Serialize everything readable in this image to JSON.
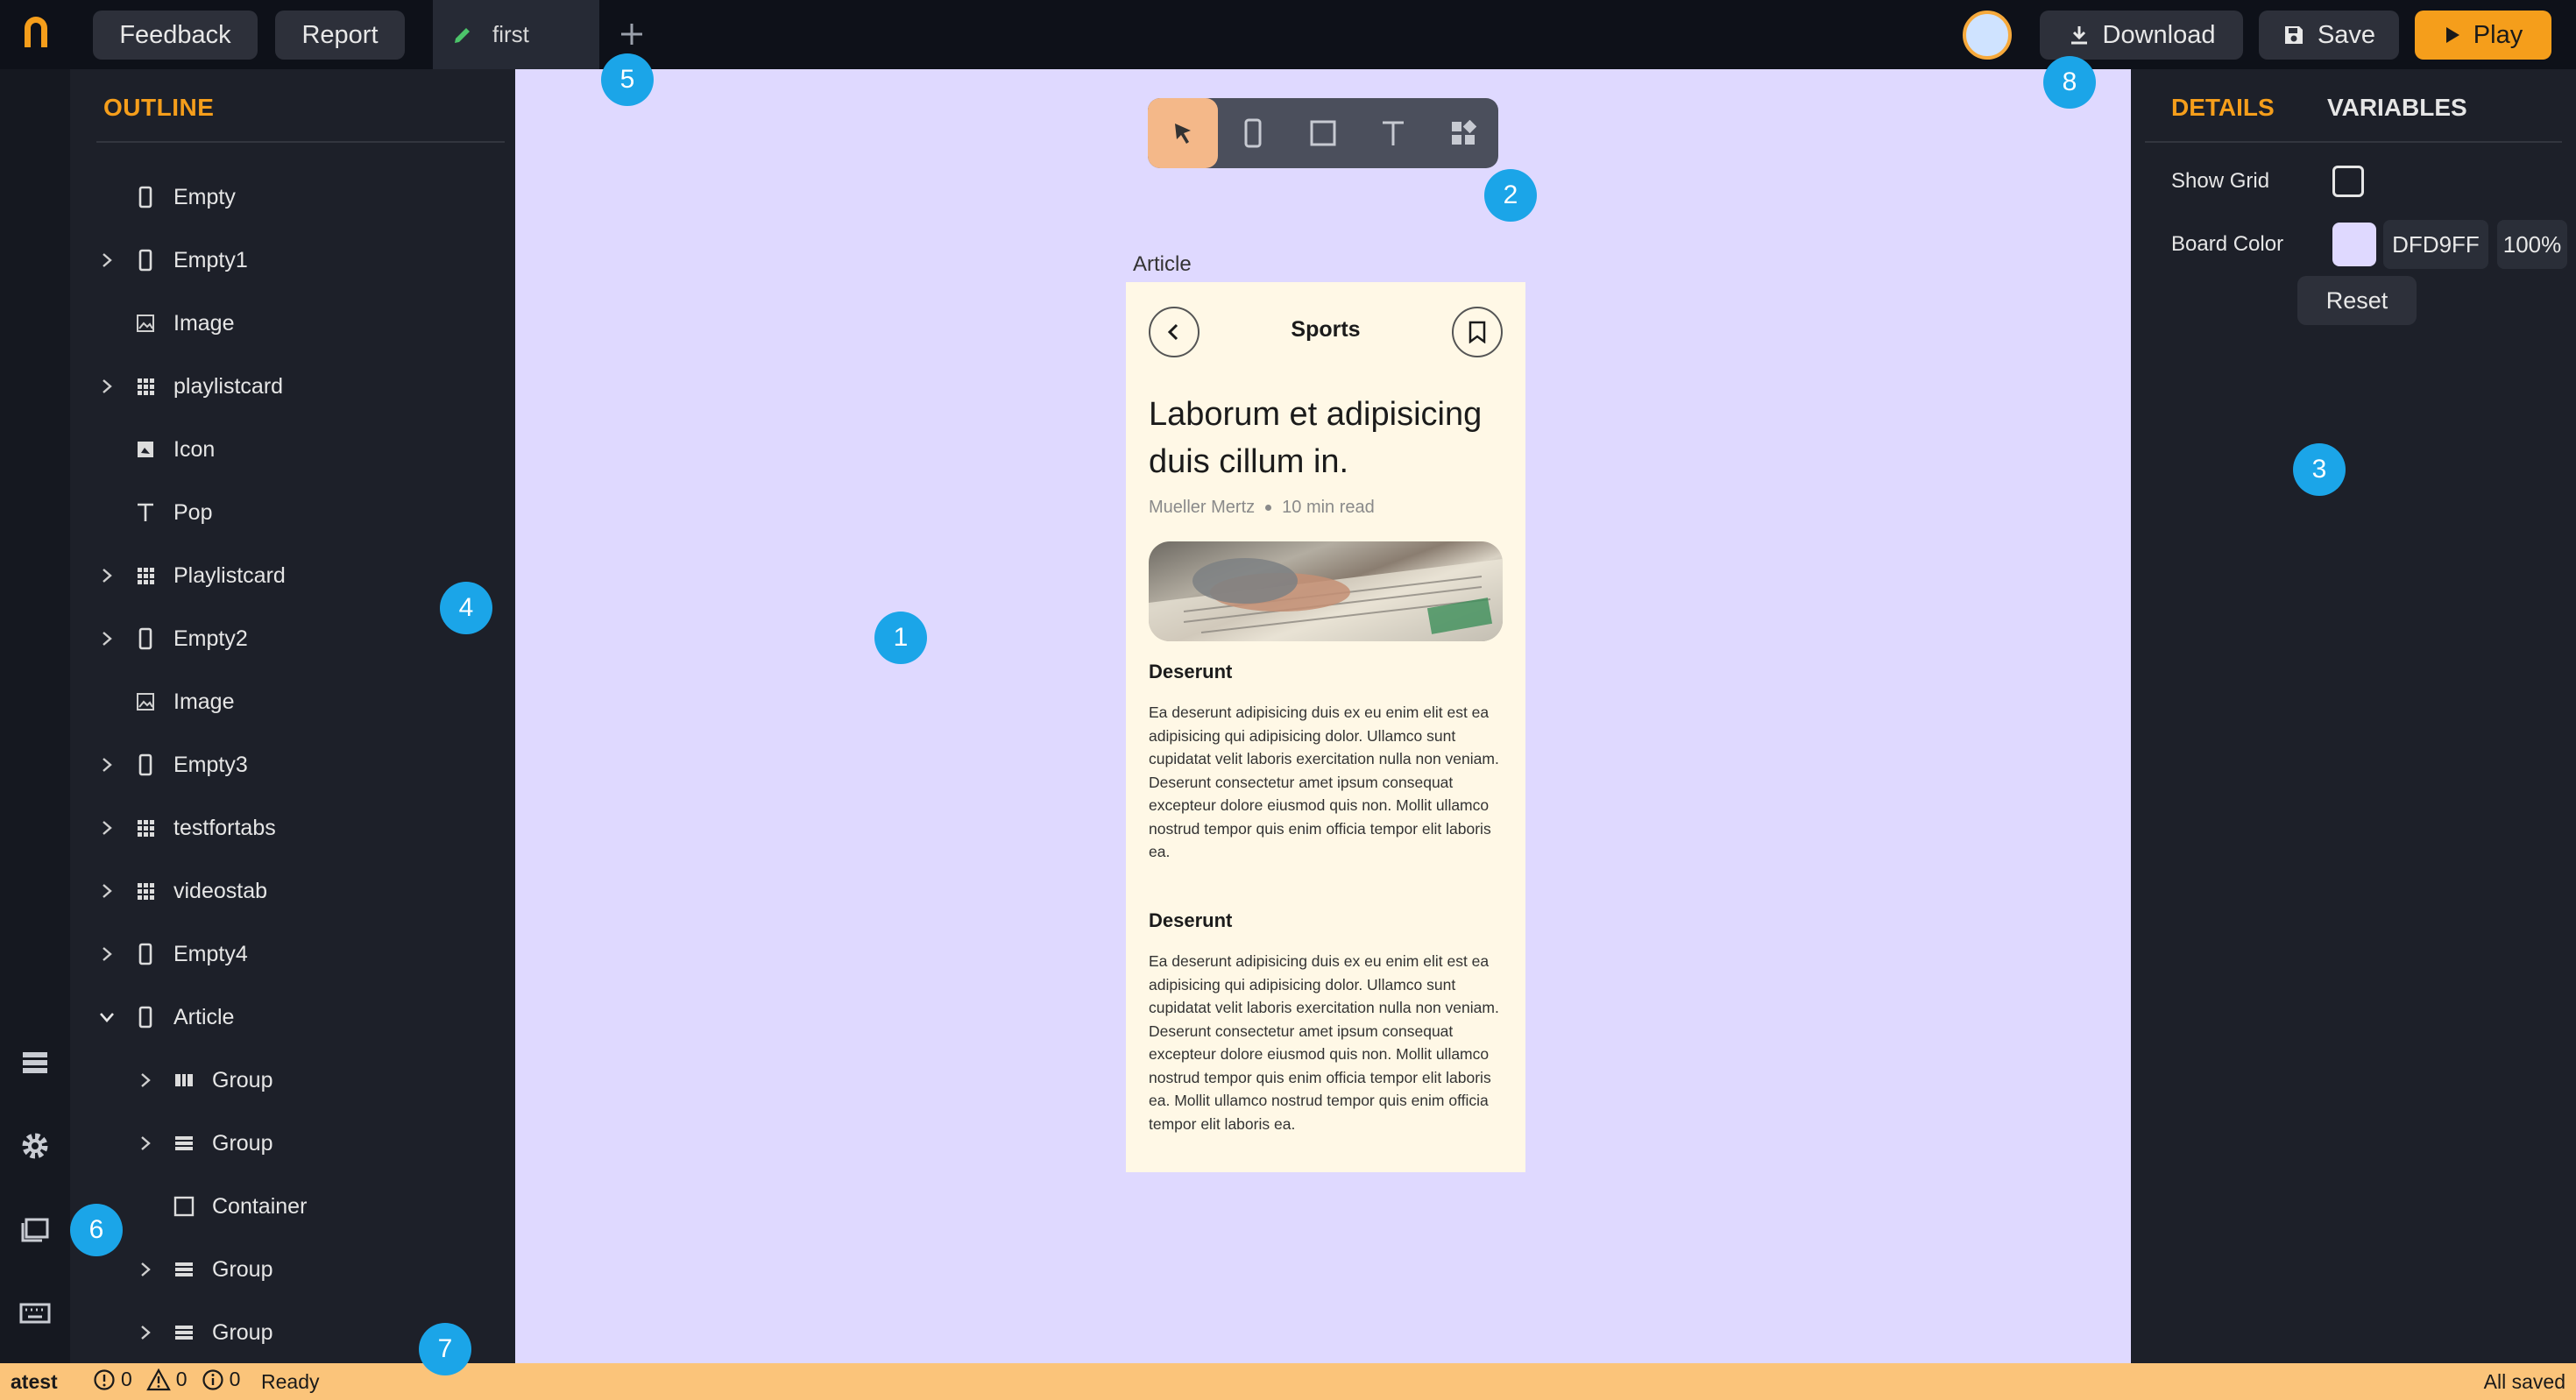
{
  "topbar": {
    "feedback_label": "Feedback",
    "report_label": "Report",
    "active_tab": "first",
    "download_label": "Download",
    "save_label": "Save",
    "play_label": "Play"
  },
  "outline": {
    "heading": "OUTLINE",
    "items": [
      {
        "label": "Empty",
        "icon": "phone-icon"
      },
      {
        "label": "Empty1",
        "icon": "phone-icon",
        "expandable": true
      },
      {
        "label": "Image",
        "icon": "image-icon"
      },
      {
        "label": "playlistcard",
        "icon": "grid-icon",
        "expandable": true
      },
      {
        "label": "Icon",
        "icon": "icon-icon"
      },
      {
        "label": "Pop",
        "icon": "text-icon"
      },
      {
        "label": "Playlistcard",
        "icon": "grid-icon",
        "expandable": true
      },
      {
        "label": "Empty2",
        "icon": "phone-icon",
        "expandable": true
      },
      {
        "label": "Image",
        "icon": "image-icon"
      },
      {
        "label": "Empty3",
        "icon": "phone-icon",
        "expandable": true
      },
      {
        "label": "testfortabs",
        "icon": "grid-icon",
        "expandable": true
      },
      {
        "label": "videostab",
        "icon": "grid-icon",
        "expandable": true
      },
      {
        "label": "Empty4",
        "icon": "phone-icon",
        "expandable": true
      },
      {
        "label": "Article",
        "icon": "phone-icon",
        "expanded": true
      },
      {
        "label": "Group",
        "icon": "columns-icon",
        "expandable": true,
        "indent": 1
      },
      {
        "label": "Group",
        "icon": "rows-icon",
        "expandable": true,
        "indent": 1
      },
      {
        "label": "Container",
        "icon": "square-icon",
        "indent": 1
      },
      {
        "label": "Group",
        "icon": "rows-icon",
        "expandable": true,
        "indent": 1
      },
      {
        "label": "Group",
        "icon": "rows-icon",
        "expandable": true,
        "indent": 1
      }
    ]
  },
  "canvas": {
    "artboard_label": "Article",
    "background": "#DFD9FF",
    "toolbar": [
      "select-tool-icon",
      "phone-tool-icon",
      "square-tool-icon",
      "text-tool-icon",
      "widgets-tool-icon"
    ],
    "article": {
      "category": "Sports",
      "title": "Laborum et adipisicing duis cillum in.",
      "author": "Mueller Mertz",
      "read_time": "10 min read",
      "section1_heading": "Deserunt",
      "section1_body": "Ea deserunt adipisicing duis ex eu enim elit est ea adipisicing qui adipisicing dolor. Ullamco sunt cupidatat velit laboris exercitation nulla non veniam. Deserunt consectetur amet ipsum consequat excepteur dolore eiusmod quis non. Mollit ullamco nostrud tempor quis enim officia tempor elit laboris ea.",
      "section2_heading": "Deserunt",
      "section2_body": "Ea deserunt adipisicing duis ex eu enim elit est ea adipisicing qui adipisicing dolor. Ullamco sunt cupidatat velit laboris exercitation nulla non veniam. Deserunt consectetur amet ipsum consequat excepteur dolore eiusmod quis non. Mollit ullamco nostrud tempor quis enim officia tempor elit laboris ea. Mollit ullamco nostrud tempor quis enim officia tempor elit laboris ea."
    }
  },
  "details": {
    "tab_details": "DETAILS",
    "tab_variables": "VARIABLES",
    "show_grid_label": "Show Grid",
    "show_grid_checked": false,
    "board_color_label": "Board Color",
    "board_color_hex": "DFD9FF",
    "board_color_opacity": "100%",
    "reset_label": "Reset"
  },
  "status": {
    "project": "atest",
    "errors": "0",
    "warnings": "0",
    "infos": "0",
    "state": "Ready",
    "save_state": "All saved"
  },
  "markers": [
    "1",
    "2",
    "3",
    "4",
    "5",
    "6",
    "7",
    "8"
  ],
  "colors": {
    "accent": "#F59E1B",
    "marker": "#1BA5E8",
    "status_bar": "#FBC47A"
  }
}
